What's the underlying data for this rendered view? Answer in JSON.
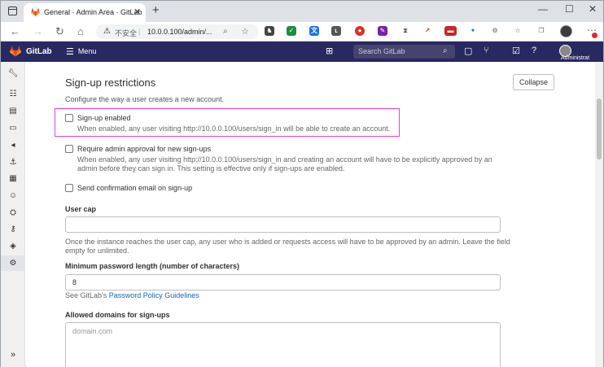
{
  "browser": {
    "tab_title": "General · Admin Area · GitLab",
    "insecure_label": "不安全",
    "url": "10.0.0.100/admin/...",
    "new_tab_icon": "plus-icon",
    "window_controls": [
      "minimize-icon",
      "maximize-icon",
      "close-icon"
    ]
  },
  "gitlab_header": {
    "brand": "GitLab",
    "menu_label": "Menu",
    "search_placeholder": "Search GitLab",
    "user_label": "Administrat",
    "brand_color": "#292961"
  },
  "sidebar": {
    "items": [
      "wrench-icon",
      "overview-icon",
      "analytics-icon",
      "monitoring-icon",
      "messages-icon",
      "hooks-icon",
      "applications-icon",
      "abuse-icon",
      "kubernetes-icon",
      "deploy-keys-icon",
      "labels-icon",
      "settings-icon"
    ],
    "active_index": 11,
    "collapse_icon": "double-chevron-right-icon"
  },
  "section": {
    "title": "Sign-up restrictions",
    "description": "Configure the way a user creates a new account.",
    "collapse_label": "Collapse"
  },
  "options": {
    "signup_enabled": {
      "label": "Sign-up enabled",
      "help": "When enabled, any user visiting http://10.0.0.100/users/sign_in will be able to create an account.",
      "checked": false
    },
    "admin_approval": {
      "label": "Require admin approval for new sign-ups",
      "help_line1": "When enabled, any user visiting http://10.0.0.100/users/sign_in and creating an account will have to be explicitly approved by an",
      "help_line2": "admin before they can sign in. This setting is effective only if sign-ups are enabled.",
      "checked": false
    },
    "confirm_email": {
      "label": "Send confirmation email on sign-up",
      "checked": false
    }
  },
  "user_cap": {
    "label": "User cap",
    "value": "",
    "help_line1": "Once the instance reaches the user cap, any user who is added or requests access will have to be approved by an admin. Leave the field",
    "help_line2": "empty for unlimited."
  },
  "min_password": {
    "label": "Minimum password length (number of characters)",
    "value": "8",
    "help_prefix": "See GitLab's ",
    "help_link": "Password Policy Guidelines"
  },
  "allowed_domains": {
    "label": "Allowed domains for sign-ups",
    "placeholder": "domain.com"
  }
}
